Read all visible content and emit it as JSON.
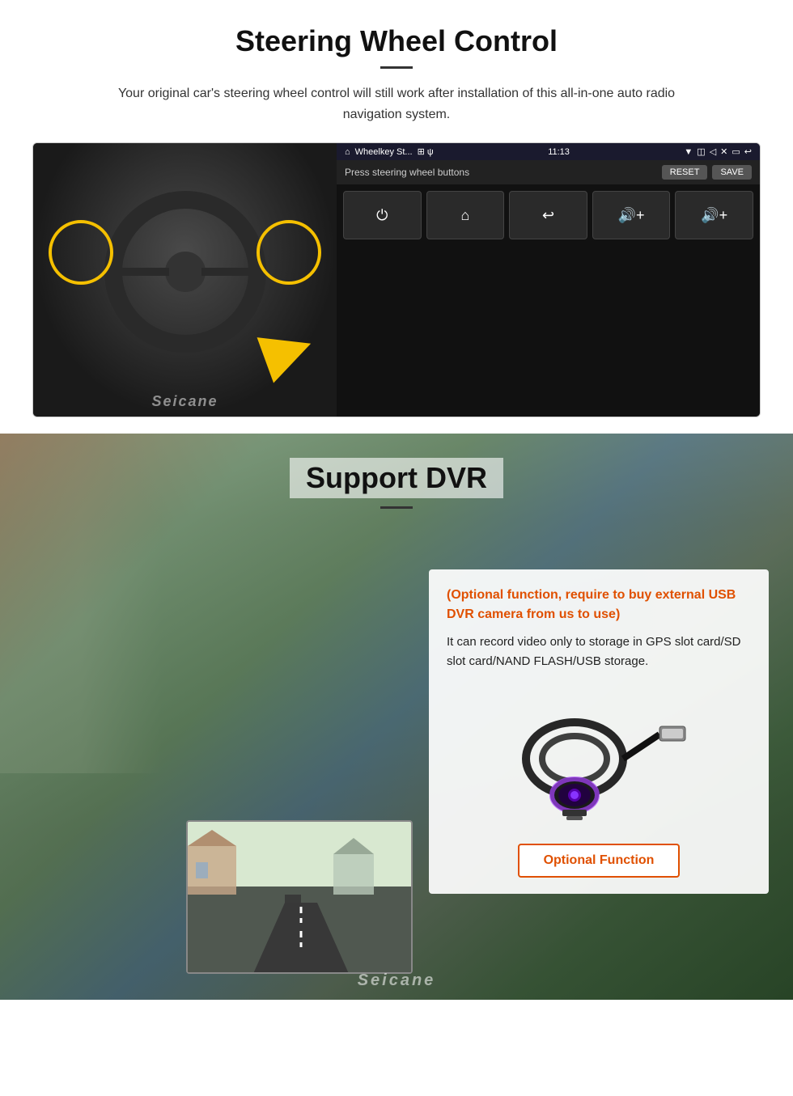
{
  "steering": {
    "title": "Steering Wheel Control",
    "subtitle": "Your original car's steering wheel control will still work after installation of this all-in-one auto radio navigation system.",
    "statusbar": {
      "app_label": "Wheelkey St...",
      "icons": "⊞ ψ",
      "time": "11:13",
      "right_icons": "◫ ◁ ✕ ▭ ↩"
    },
    "toolbar": {
      "press_label": "Press steering wheel buttons",
      "reset_btn": "RESET",
      "save_btn": "SAVE"
    },
    "controls": [
      "⏻",
      "⌂",
      "↩",
      "🔊+",
      "🔊+"
    ],
    "watermark": "Seicane"
  },
  "dvr": {
    "title": "Support DVR",
    "infobox": {
      "title": "(Optional function, require to buy external USB DVR camera from us to use)",
      "body": "It can record video only to storage in GPS slot card/SD slot card/NAND FLASH/USB storage."
    },
    "optional_function_label": "Optional Function",
    "watermark": "Seicane"
  }
}
